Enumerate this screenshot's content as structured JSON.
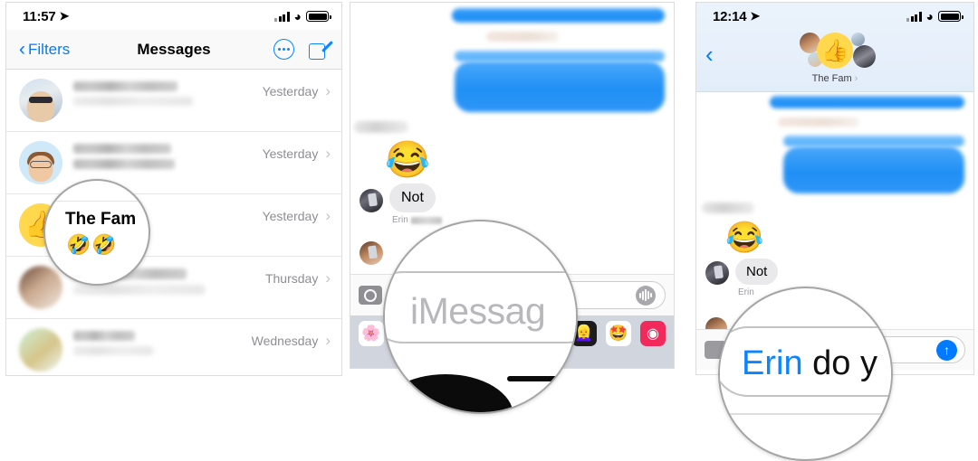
{
  "panel1": {
    "status": {
      "time": "11:57",
      "location_icon": "location-arrow-icon",
      "wifi_icon": "wifi-icon",
      "battery_icon": "battery-icon",
      "signal_icon": "cellular-bars-icon"
    },
    "nav": {
      "back_label": "Filters",
      "back_icon": "chevron-left-icon",
      "title": "Messages",
      "more_icon": "more-circle-icon",
      "compose_icon": "compose-icon"
    },
    "rows": [
      {
        "name": "",
        "preview": "",
        "date": "Yesterday",
        "chevron": "›",
        "avatar": "photo-avatar"
      },
      {
        "name": "",
        "preview": "",
        "date": "Yesterday",
        "chevron": "›",
        "avatar": "memoji-avatar"
      },
      {
        "name": "The Fam",
        "preview": "",
        "date": "Yesterday",
        "chevron": "›",
        "avatar": "thumbsup-avatar"
      },
      {
        "name": "",
        "preview": "",
        "date": "Thursday",
        "chevron": "›",
        "avatar": "blurred-avatar-a"
      },
      {
        "name": "",
        "preview": "",
        "date": "Wednesday",
        "chevron": "›",
        "avatar": "blurred-avatar-b"
      }
    ],
    "magnifier": {
      "title": "The Fam",
      "emoji": "🤣🤣"
    }
  },
  "panel2": {
    "emoji_reaction": "😂",
    "incoming_bubble": "Not",
    "sender_label": "Erin",
    "input": {
      "placeholder": "iMessage",
      "camera_icon": "camera-icon",
      "mic_icon": "audio-waveform-icon"
    },
    "drawer": {
      "apps": [
        {
          "icon": "photos-app-icon",
          "glyph": "🌸"
        },
        {
          "icon": "memoji-dark-app-icon",
          "glyph": "👱‍♀️"
        },
        {
          "icon": "memoji-light-app-icon",
          "glyph": "🤩"
        },
        {
          "icon": "music-app-icon",
          "glyph": "◉"
        }
      ]
    },
    "magnifier": {
      "text": "iMessag"
    }
  },
  "panel3": {
    "status": {
      "time": "12:14",
      "location_icon": "location-arrow-icon",
      "wifi_icon": "wifi-icon",
      "battery_icon": "battery-icon",
      "signal_icon": "cellular-bars-icon"
    },
    "nav": {
      "back_icon": "chevron-left-icon",
      "group_name": "The Fam",
      "group_chevron": "›",
      "group_emoji": "👍"
    },
    "emoji_reaction": "😂",
    "incoming_bubble": "Not",
    "sender_label": "Erin",
    "input": {
      "value_mention": "Erin",
      "value_rest": " do yo",
      "camera_icon": "camera-icon",
      "send_icon": "↑"
    },
    "magnifier": {
      "mention": "Erin",
      "rest": " do y"
    }
  }
}
